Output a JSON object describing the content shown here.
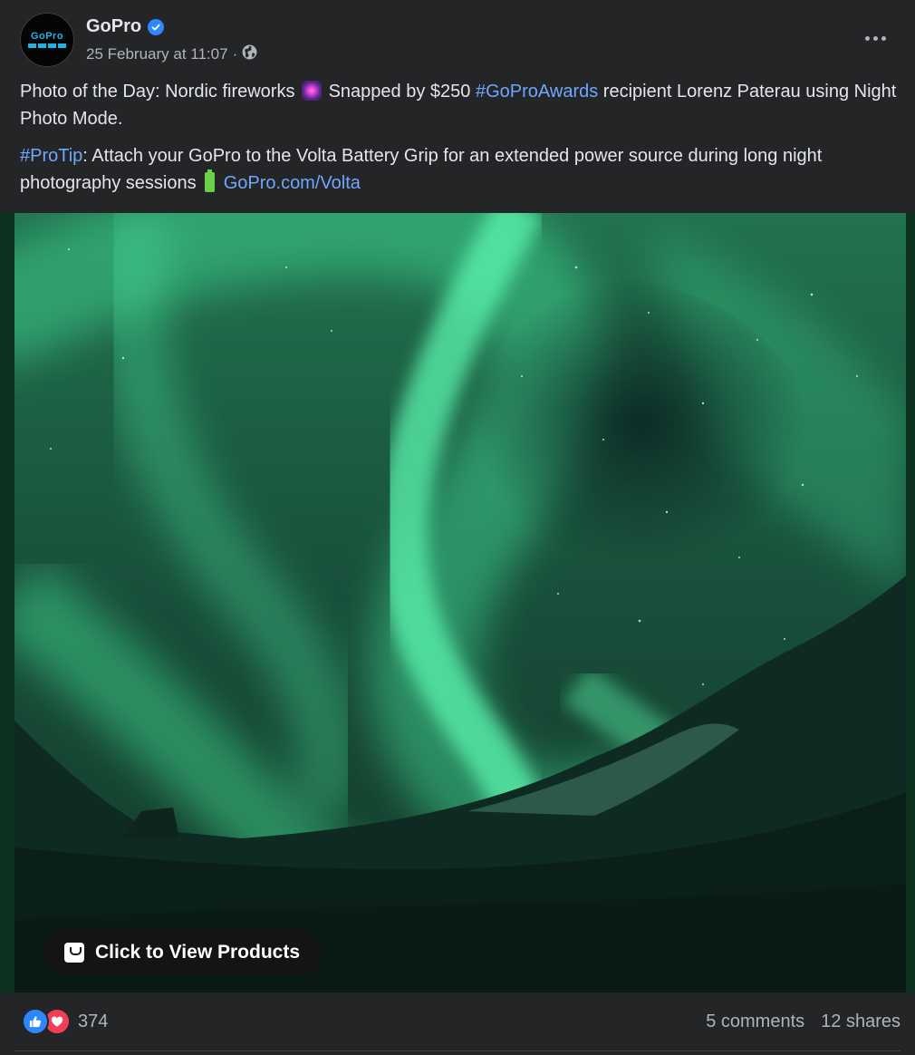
{
  "post": {
    "page_name": "GoPro",
    "timestamp": "25 February at 11:07",
    "separator": "·",
    "avatar_logo": "GoPro",
    "icons": {
      "verified": "verified-badge-icon",
      "audience": "globe-icon",
      "more": "more-options-icon"
    },
    "text": {
      "p1_a": "Photo of the Day: Nordic fireworks",
      "p1_emoji": "fireworks-emoji",
      "p1_b": "Snapped by $250",
      "p1_hashtag": "#GoProAwards",
      "p1_c": "recipient Lorenz Paterau using Night Photo Mode.",
      "p2_hashtag": "#ProTip",
      "p2_a": ": Attach your GoPro to the Volta Battery Grip for an extended power source during long night photography sessions",
      "p2_emoji": "battery-emoji",
      "p2_link": "GoPro.com/Volta"
    },
    "photo": {
      "subject": "aurora-borealis-over-mountains"
    },
    "shop_button": "Click to View Products",
    "reactions": {
      "types": [
        "like",
        "love"
      ],
      "count": "374"
    },
    "comments": "5 comments",
    "shares": "12 shares"
  },
  "colors": {
    "background": "#242526",
    "text_primary": "#e4e6eb",
    "text_secondary": "#b0b3b8",
    "link": "#6fa7ff",
    "verified": "#2d88ff",
    "like": "#2d88ff",
    "love": "#f33e58"
  }
}
